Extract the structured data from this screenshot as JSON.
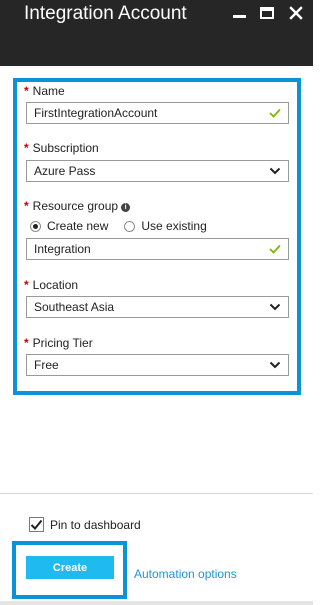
{
  "header": {
    "title": "Integration Account",
    "icons": [
      "minimize-icon",
      "maximize-icon",
      "close-icon"
    ]
  },
  "form": {
    "required_marker": "*",
    "name": {
      "label": "Name",
      "value": "FirstIntegrationAccount",
      "valid": true
    },
    "subscription": {
      "label": "Subscription",
      "value": "Azure Pass"
    },
    "resource_group": {
      "label": "Resource group",
      "info_glyph": "i",
      "options": [
        "Create new",
        "Use existing"
      ],
      "selected": "Create new",
      "value": "Integration",
      "valid": true
    },
    "location": {
      "label": "Location",
      "value": "Southeast Asia"
    },
    "pricing_tier": {
      "label": "Pricing Tier",
      "value": "Free"
    }
  },
  "footer": {
    "pin_label": "Pin to dashboard",
    "pin_checked": true,
    "create_label": "Create",
    "automation_label": "Automation options"
  },
  "colors": {
    "header_bg": "#262626",
    "highlight": "#0a93d8",
    "create_button": "#1ebaf0",
    "link": "#1a96d6",
    "valid_check": "#7ab800",
    "required": "#cc0000"
  }
}
